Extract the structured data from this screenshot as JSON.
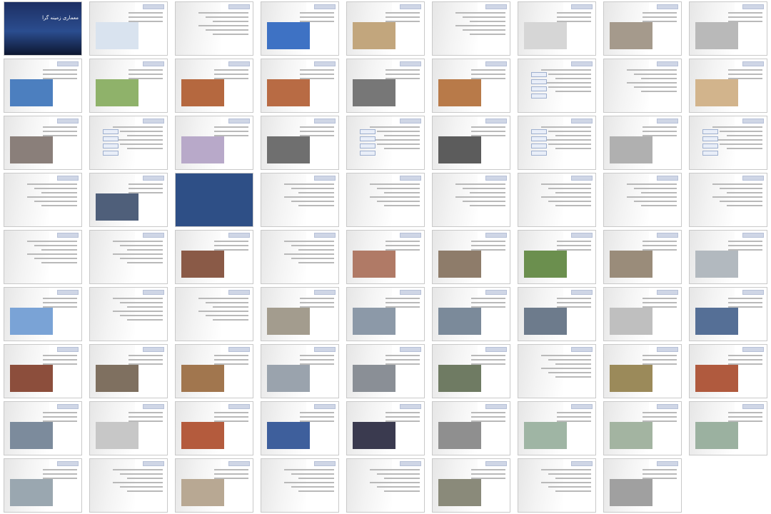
{
  "window": {
    "title": ""
  },
  "slides": [
    {
      "n": 1,
      "kind": "cover",
      "title": "معماری زمینه گرا",
      "accent": "#2b4d8f"
    },
    {
      "n": 2,
      "kind": "photo",
      "photo": "#d9e3ef"
    },
    {
      "n": 3,
      "kind": "text"
    },
    {
      "n": 4,
      "kind": "photo",
      "photo": "#3e72c4"
    },
    {
      "n": 5,
      "kind": "photo",
      "photo": "#c2a67d"
    },
    {
      "n": 6,
      "kind": "text"
    },
    {
      "n": 7,
      "kind": "photo",
      "photo": "#d6d6d6"
    },
    {
      "n": 8,
      "kind": "photo",
      "photo": "#a59a8c"
    },
    {
      "n": 9,
      "kind": "photo",
      "photo": "#b9b9b9"
    },
    {
      "n": 10,
      "kind": "photo",
      "photo": "#4c7fbf"
    },
    {
      "n": 11,
      "kind": "photo",
      "photo": "#8fb26a"
    },
    {
      "n": 12,
      "kind": "photo",
      "photo": "#b5683f"
    },
    {
      "n": 13,
      "kind": "photo",
      "photo": "#b86b44"
    },
    {
      "n": 14,
      "kind": "photo",
      "photo": "#777777"
    },
    {
      "n": 15,
      "kind": "photo",
      "photo": "#b87a49"
    },
    {
      "n": 16,
      "kind": "boxes"
    },
    {
      "n": 17,
      "kind": "text"
    },
    {
      "n": 18,
      "kind": "photo",
      "photo": "#d2b48c"
    },
    {
      "n": 19,
      "kind": "photo",
      "photo": "#8a7f7a"
    },
    {
      "n": 20,
      "kind": "boxes"
    },
    {
      "n": 21,
      "kind": "photo",
      "photo": "#b8a9c9"
    },
    {
      "n": 22,
      "kind": "photo",
      "photo": "#6f6f6f"
    },
    {
      "n": 23,
      "kind": "boxes"
    },
    {
      "n": 24,
      "kind": "photo",
      "photo": "#5c5c5c"
    },
    {
      "n": 25,
      "kind": "boxes"
    },
    {
      "n": 26,
      "kind": "photo",
      "photo": "#b0b0b0"
    },
    {
      "n": 27,
      "kind": "boxes"
    },
    {
      "n": 28,
      "kind": "text"
    },
    {
      "n": 29,
      "kind": "photo",
      "photo": "#4f5f7a"
    },
    {
      "n": 30,
      "kind": "blue",
      "accent": "#2e4f86"
    },
    {
      "n": 31,
      "kind": "text"
    },
    {
      "n": 32,
      "kind": "text"
    },
    {
      "n": 33,
      "kind": "text"
    },
    {
      "n": 34,
      "kind": "text"
    },
    {
      "n": 35,
      "kind": "text"
    },
    {
      "n": 36,
      "kind": "text"
    },
    {
      "n": 37,
      "kind": "text"
    },
    {
      "n": 38,
      "kind": "text"
    },
    {
      "n": 39,
      "kind": "photo",
      "photo": "#8a5a47"
    },
    {
      "n": 40,
      "kind": "text"
    },
    {
      "n": 41,
      "kind": "photo",
      "photo": "#b07a66"
    },
    {
      "n": 42,
      "kind": "photo",
      "photo": "#8e7c6a"
    },
    {
      "n": 43,
      "kind": "photo",
      "photo": "#6b8f4e"
    },
    {
      "n": 44,
      "kind": "photo",
      "photo": "#9a8c7a"
    },
    {
      "n": 45,
      "kind": "photo",
      "photo": "#b2b9bf"
    },
    {
      "n": 46,
      "kind": "photo",
      "photo": "#7aa3d6"
    },
    {
      "n": 47,
      "kind": "text"
    },
    {
      "n": 48,
      "kind": "text"
    },
    {
      "n": 49,
      "kind": "photo",
      "photo": "#a39c8e"
    },
    {
      "n": 50,
      "kind": "photo",
      "photo": "#8c99a8"
    },
    {
      "n": 51,
      "kind": "photo",
      "photo": "#7b8a9a"
    },
    {
      "n": 52,
      "kind": "photo",
      "photo": "#6d7b8c"
    },
    {
      "n": 53,
      "kind": "photo",
      "photo": "#bfbfbf"
    },
    {
      "n": 54,
      "kind": "photo",
      "photo": "#556f96"
    },
    {
      "n": 55,
      "kind": "photo",
      "photo": "#8c4e3c"
    },
    {
      "n": 56,
      "kind": "photo",
      "photo": "#7f7060"
    },
    {
      "n": 57,
      "kind": "photo",
      "photo": "#a1764e"
    },
    {
      "n": 58,
      "kind": "photo",
      "photo": "#9aa3ad"
    },
    {
      "n": 59,
      "kind": "photo",
      "photo": "#8a8f96"
    },
    {
      "n": 60,
      "kind": "photo",
      "photo": "#6f7b63"
    },
    {
      "n": 61,
      "kind": "text"
    },
    {
      "n": 62,
      "kind": "photo",
      "photo": "#9b8a5a"
    },
    {
      "n": 63,
      "kind": "photo",
      "photo": "#b05a3e"
    },
    {
      "n": 64,
      "kind": "photo",
      "photo": "#7c8b9c"
    },
    {
      "n": 65,
      "kind": "photo",
      "photo": "#c7c7c7"
    },
    {
      "n": 66,
      "kind": "photo",
      "photo": "#b45b3d"
    },
    {
      "n": 67,
      "kind": "photo",
      "photo": "#3e5f9c"
    },
    {
      "n": 68,
      "kind": "photo",
      "photo": "#3a3a4f"
    },
    {
      "n": 69,
      "kind": "photo",
      "photo": "#8f8f8f"
    },
    {
      "n": 70,
      "kind": "photo",
      "photo": "#9fb5a4"
    },
    {
      "n": 71,
      "kind": "photo",
      "photo": "#a3b4a1"
    },
    {
      "n": 72,
      "kind": "photo",
      "photo": "#9bb1a0"
    },
    {
      "n": 73,
      "kind": "photo",
      "photo": "#9aa7b0"
    },
    {
      "n": 74,
      "kind": "text"
    },
    {
      "n": 75,
      "kind": "photo",
      "photo": "#b8a893"
    },
    {
      "n": 76,
      "kind": "text"
    },
    {
      "n": 77,
      "kind": "text"
    },
    {
      "n": 78,
      "kind": "photo",
      "photo": "#8a8a7a"
    },
    {
      "n": 79,
      "kind": "text"
    },
    {
      "n": 80,
      "kind": "photo",
      "photo": "#a0a0a0"
    }
  ]
}
